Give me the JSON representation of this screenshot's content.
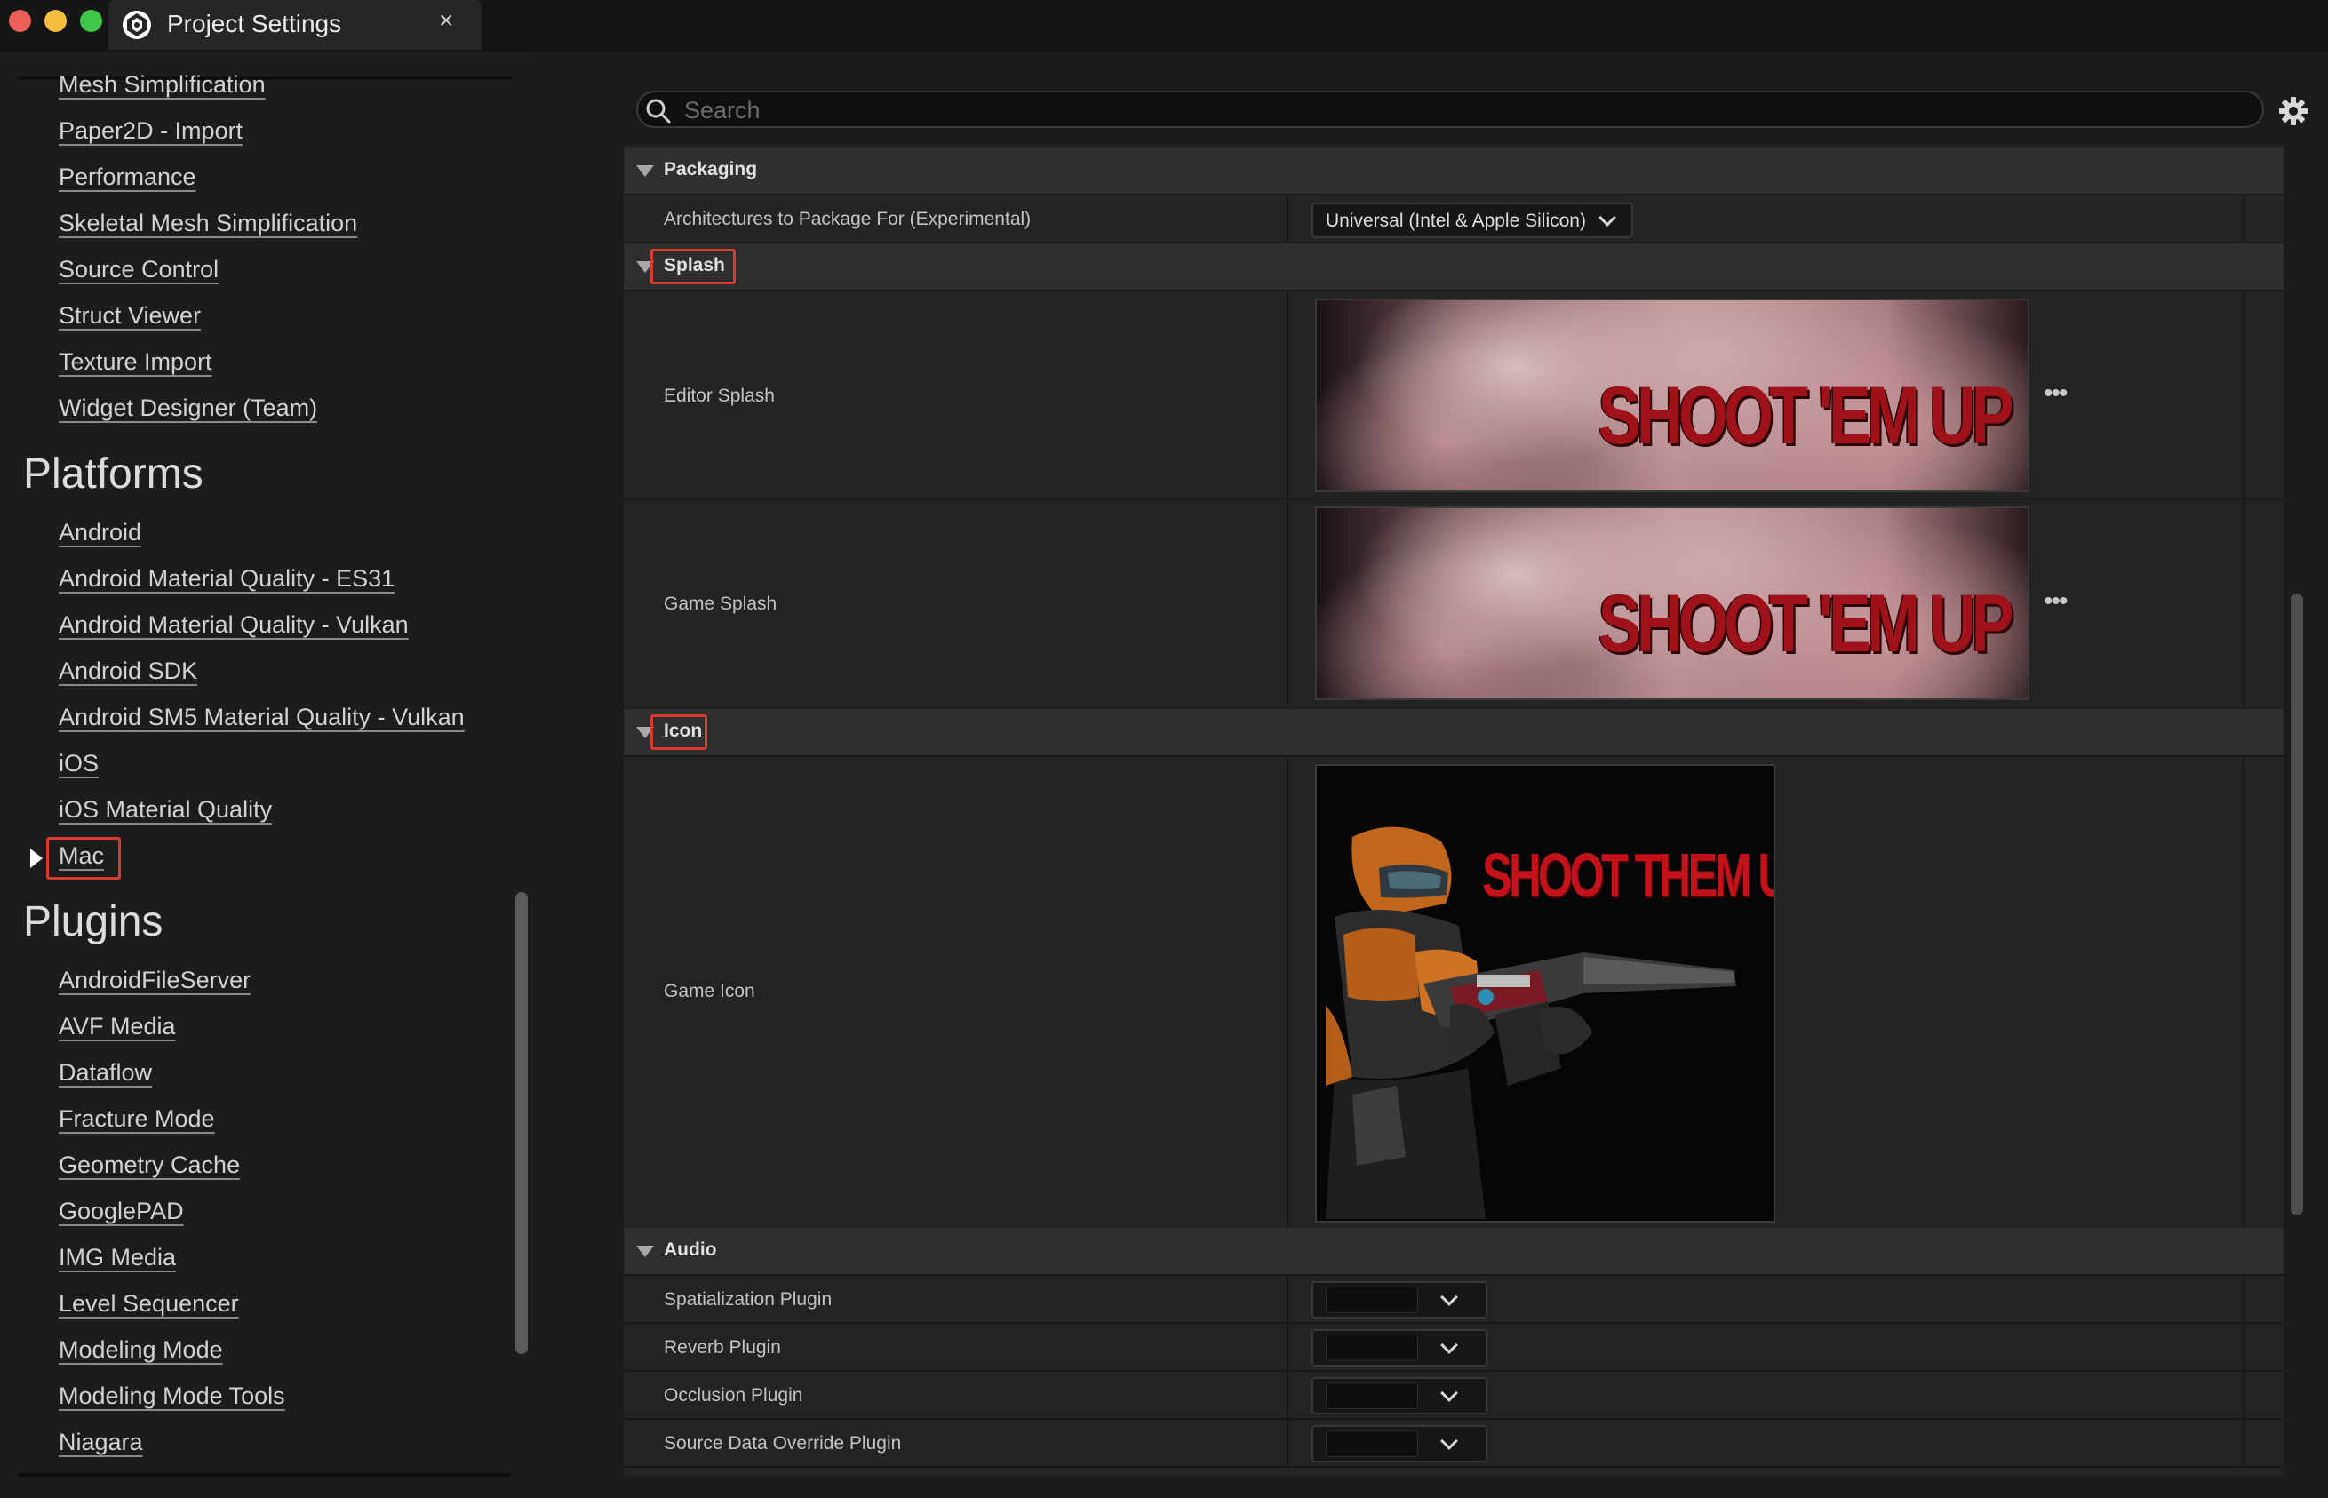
{
  "window": {
    "tab_title": "Project Settings",
    "close_glyph": "×"
  },
  "sidebar": {
    "top_items": [
      "Mesh Simplification",
      "Paper2D - Import",
      "Performance",
      "Skeletal Mesh Simplification",
      "Source Control",
      "Struct Viewer",
      "Texture Import",
      "Widget Designer (Team)"
    ],
    "platforms_heading": "Platforms",
    "platforms": [
      "Android",
      "Android Material Quality - ES31",
      "Android Material Quality - Vulkan",
      "Android SDK",
      "Android SM5 Material Quality - Vulkan",
      "iOS",
      "iOS Material Quality",
      "Mac"
    ],
    "plugins_heading": "Plugins",
    "plugins": [
      "AndroidFileServer",
      "AVF Media",
      "Dataflow",
      "Fracture Mode",
      "Geometry Cache",
      "GooglePAD",
      "IMG Media",
      "Level Sequencer",
      "Modeling Mode",
      "Modeling Mode Tools",
      "Niagara"
    ],
    "selected": "Mac"
  },
  "search": {
    "placeholder": "Search"
  },
  "packaging": {
    "label": "Packaging",
    "rows": [
      {
        "label": "Architectures to Package For (Experimental)",
        "value": "Universal (Intel & Apple Silicon)"
      }
    ]
  },
  "splash": {
    "label": "Splash",
    "rows": [
      {
        "label": "Editor Splash",
        "image_text": "SHOOT 'EM UP"
      },
      {
        "label": "Game Splash",
        "image_text": "SHOOT 'EM UP"
      }
    ]
  },
  "icon": {
    "label": "Icon",
    "rows": [
      {
        "label": "Game Icon",
        "image_text": "SHOOT THEM UP"
      }
    ]
  },
  "audio": {
    "label": "Audio",
    "rows": [
      {
        "label": "Spatialization Plugin"
      },
      {
        "label": "Reverb Plugin"
      },
      {
        "label": "Occlusion Plugin"
      },
      {
        "label": "Source Data Override Plugin"
      }
    ]
  },
  "colors": {
    "highlight": "#d83b2e",
    "category_bg": "#2f2f2f",
    "row_bg": "#232323"
  },
  "icons": [
    "unreal-logo-icon",
    "close-icon",
    "search-icon",
    "settings-gear-icon",
    "expand-arrow-icon",
    "collapse-arrow-icon",
    "chevron-down-icon",
    "more-options-icon"
  ]
}
